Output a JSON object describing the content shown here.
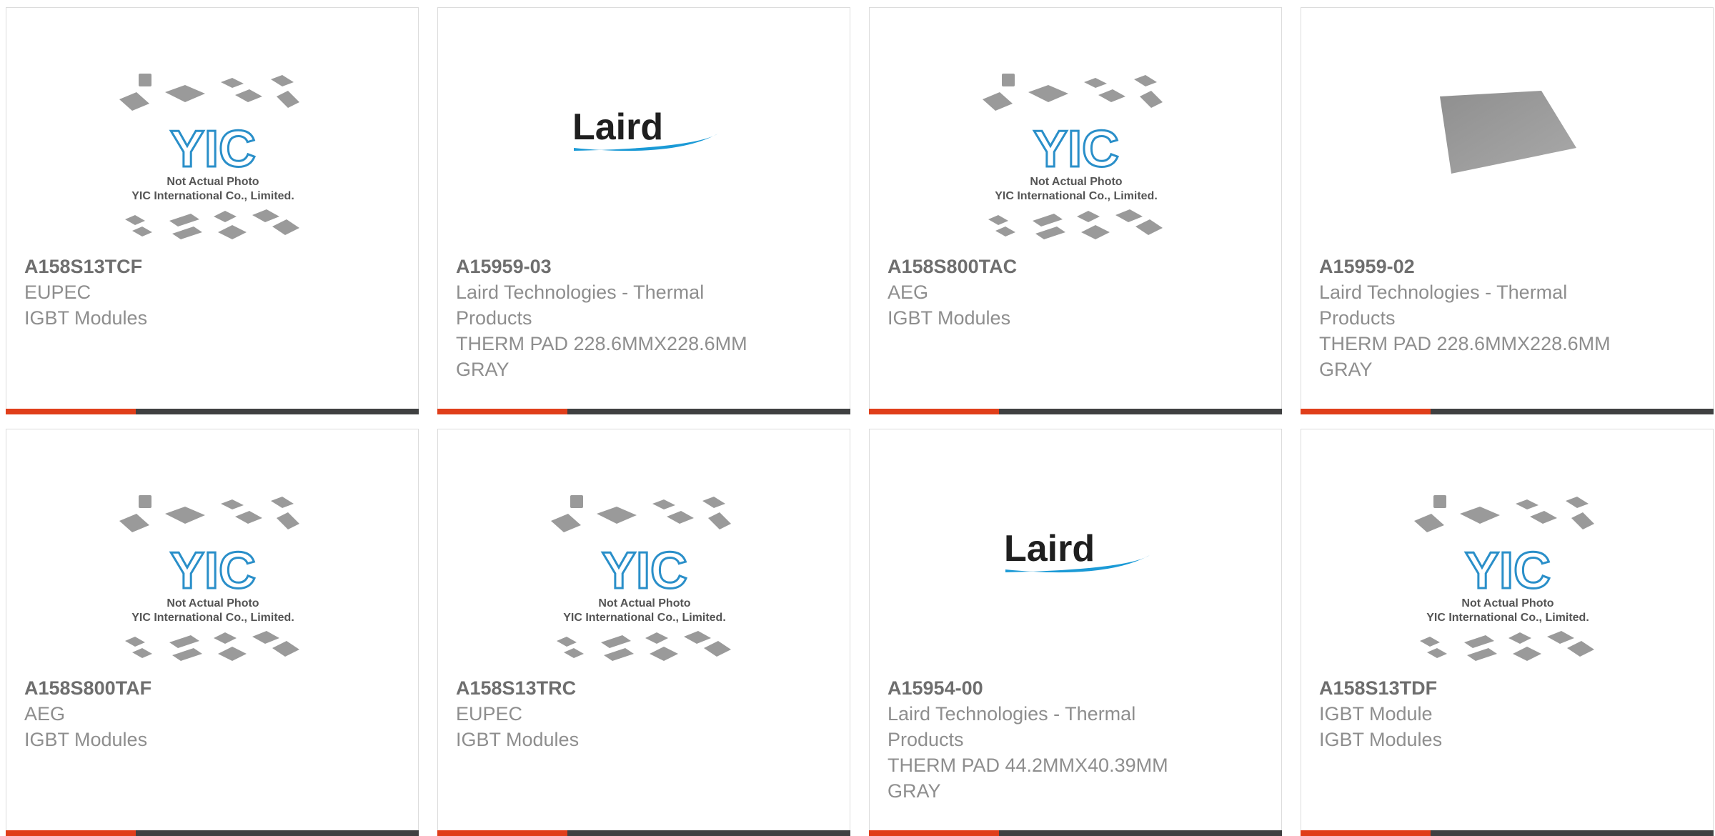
{
  "products": [
    {
      "part": "A158S13TCF",
      "manufacturer": "EUPEC",
      "description": "IGBT Modules",
      "image": "yic-placeholder"
    },
    {
      "part": "A15959-03",
      "manufacturer": "Laird Technologies - Thermal Products",
      "description": "THERM PAD 228.6MMX228.6MM GRAY",
      "image": "laird-logo"
    },
    {
      "part": "A158S800TAC",
      "manufacturer": "AEG",
      "description": "IGBT Modules",
      "image": "yic-placeholder"
    },
    {
      "part": "A15959-02",
      "manufacturer": "Laird Technologies - Thermal Products",
      "description": "THERM PAD 228.6MMX228.6MM GRAY",
      "image": "gray-thermal-pad"
    },
    {
      "part": "A158S800TAF",
      "manufacturer": "AEG",
      "description": "IGBT Modules",
      "image": "yic-placeholder"
    },
    {
      "part": "A158S13TRC",
      "manufacturer": "EUPEC",
      "description": "IGBT Modules",
      "image": "yic-placeholder"
    },
    {
      "part": "A15954-00",
      "manufacturer": "Laird Technologies - Thermal Products",
      "description": "THERM PAD 44.2MMX40.39MM GRAY",
      "image": "laird-logo"
    },
    {
      "part": "A158S13TDF",
      "manufacturer": "IGBT Module",
      "description": "IGBT Modules",
      "image": "yic-placeholder"
    }
  ],
  "placeholder": {
    "caption_line1": "Not Actual Photo",
    "caption_line2": "YIC International Co., Limited.",
    "logo_text": "YIC"
  },
  "laird": {
    "logo_text": "Laird"
  },
  "colors": {
    "accent": "#e03e1a",
    "bar": "#3f4041",
    "yic_blue": "#2a8fc9",
    "laird_blue": "#1b9ad6"
  }
}
